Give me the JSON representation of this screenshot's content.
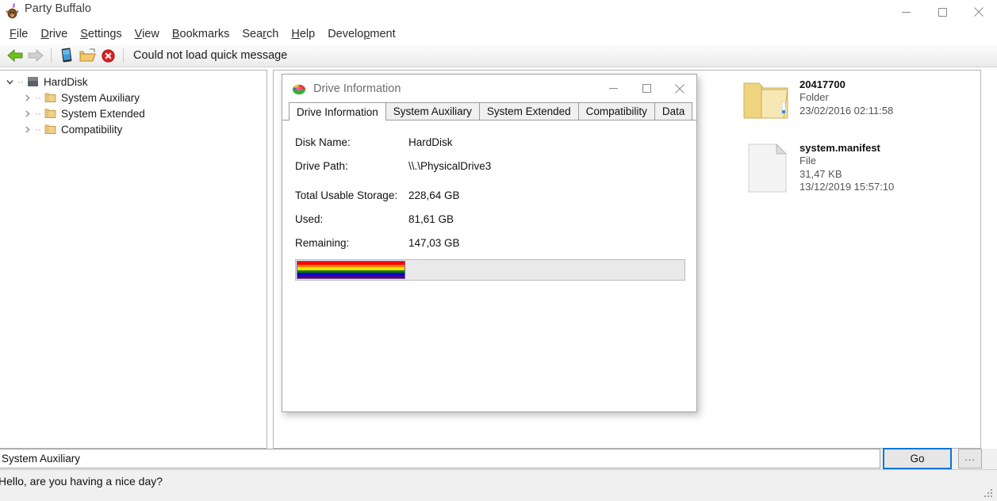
{
  "window": {
    "title": "Party Buffalo",
    "icon": "buffalo-party-icon",
    "controls": {
      "minimize": "minimize-icon",
      "maximize": "maximize-icon",
      "close": "close-icon"
    }
  },
  "menubar": {
    "items": [
      {
        "label": "File",
        "accel": "F"
      },
      {
        "label": "Drive",
        "accel": "D"
      },
      {
        "label": "Settings",
        "accel": "S"
      },
      {
        "label": "View",
        "accel": "V"
      },
      {
        "label": "Bookmarks",
        "accel": "B"
      },
      {
        "label": "Search",
        "accel": "r"
      },
      {
        "label": "Help",
        "accel": "H"
      },
      {
        "label": "Development",
        "accel": "p"
      }
    ]
  },
  "toolbar": {
    "back": "back-arrow-icon",
    "forward": "forward-arrow-icon",
    "device": "device-icon",
    "open_folder": "open-folder-icon",
    "error": "error-icon",
    "message": "Could not load quick message"
  },
  "tree": {
    "items": [
      {
        "label": "HardDisk",
        "expanded": true,
        "level": 0,
        "icon": "harddisk-icon"
      },
      {
        "label": "System Auxiliary",
        "expanded": false,
        "level": 1,
        "icon": "folder-icon"
      },
      {
        "label": "System Extended",
        "expanded": false,
        "level": 1,
        "icon": "folder-icon"
      },
      {
        "label": "Compatibility",
        "expanded": false,
        "level": 1,
        "icon": "folder-icon"
      }
    ]
  },
  "files": [
    {
      "name": "20417700",
      "type": "Folder",
      "size": "",
      "modified": "23/02/2016 02:11:58",
      "icon": "folder-icon"
    },
    {
      "name": "system.manifest",
      "type": "File",
      "size": "31,47 KB",
      "modified": "13/12/2019 15:57:10",
      "icon": "file-icon"
    }
  ],
  "dialog": {
    "title": "Drive Information",
    "icon": "drive-pie-icon",
    "controls": {
      "minimize": "minimize-icon",
      "maximize": "maximize-icon",
      "close": "close-icon"
    },
    "tabs": [
      {
        "label": "Drive Information",
        "active": true
      },
      {
        "label": "System Auxiliary",
        "active": false
      },
      {
        "label": "System Extended",
        "active": false
      },
      {
        "label": "Compatibility",
        "active": false
      },
      {
        "label": "Data",
        "active": false
      }
    ],
    "fields": [
      {
        "label": "Disk Name:",
        "value": "HardDisk"
      },
      {
        "label": "Drive Path:",
        "value": "\\\\.\\PhysicalDrive3"
      },
      {
        "label": "Total Usable Storage:",
        "value": "228,64 GB"
      },
      {
        "label": "Used:",
        "value": "81,61 GB"
      },
      {
        "label": "Remaining:",
        "value": "147,03 GB"
      }
    ],
    "usage_bar": {
      "percent": 28,
      "stripes": [
        "#ff0000",
        "#ff8000",
        "#ffe000",
        "#008000",
        "#0000e0",
        "#4b0082"
      ],
      "border": "#7a5fa8",
      "track": "#e9e9e9"
    }
  },
  "address": {
    "value": "System Auxiliary",
    "go_label": "Go",
    "more_label": "..."
  },
  "status": {
    "message": "Hello, are you having a nice day?",
    "grip": "resize-grip-icon"
  }
}
